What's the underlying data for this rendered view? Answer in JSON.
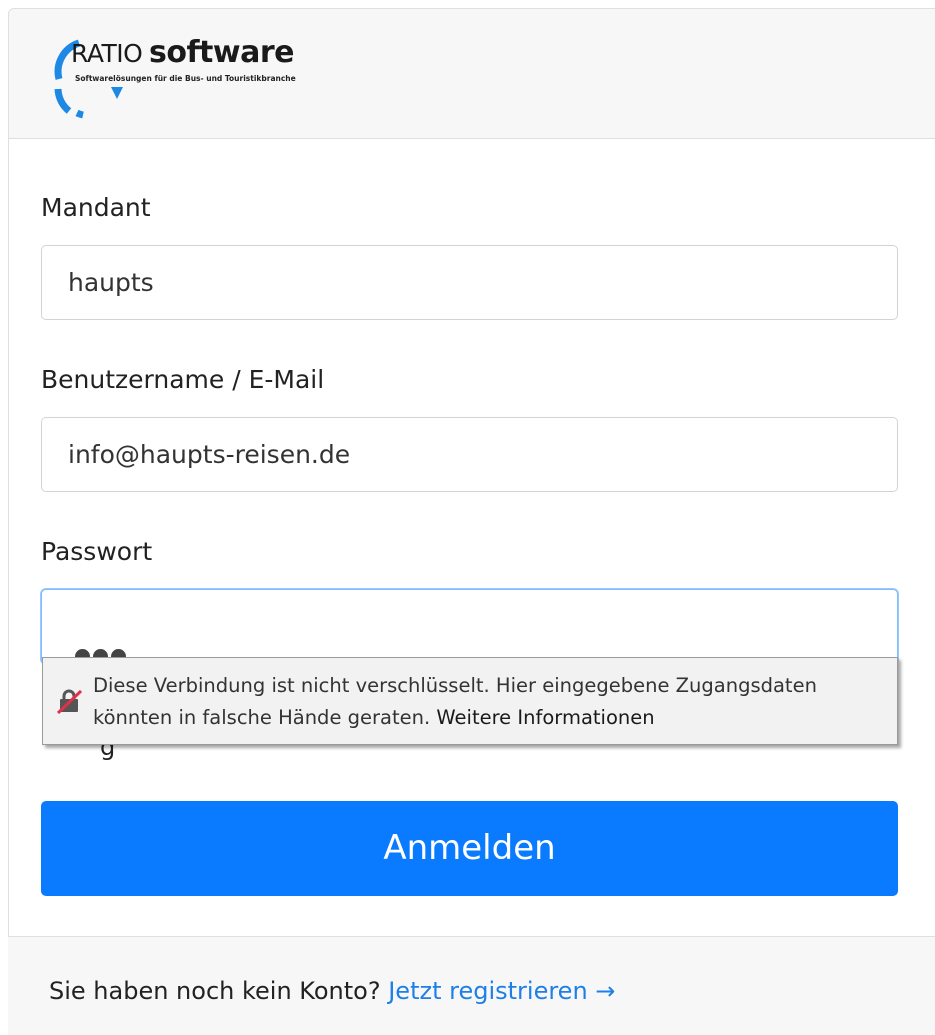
{
  "brand": {
    "name_part1": "RATIO",
    "name_part2": "software",
    "tagline": "Softwarelösungen für die Bus- und Touristikbranche"
  },
  "form": {
    "mandant_label": "Mandant",
    "mandant_value": "haupts",
    "username_label": "Benutzername / E-Mail",
    "username_value": "info@haupts-reisen.de",
    "password_label": "Passwort",
    "password_masked_count": 3,
    "remember_label_partial": "g",
    "submit_label": "Anmelden"
  },
  "security_warning": {
    "line1": "Diese Verbindung ist nicht verschlüsselt. Hier eingegebene Zugangsdaten",
    "line2_text": "könnten in falsche Hände geraten.",
    "link": "Weitere Informationen"
  },
  "footer": {
    "text": "Sie haben noch kein Konto?",
    "link": "Jetzt registrieren →"
  },
  "colors": {
    "primary": "#0a7bff",
    "link": "#1f7fe8",
    "logo_blue": "#1e88e5"
  }
}
